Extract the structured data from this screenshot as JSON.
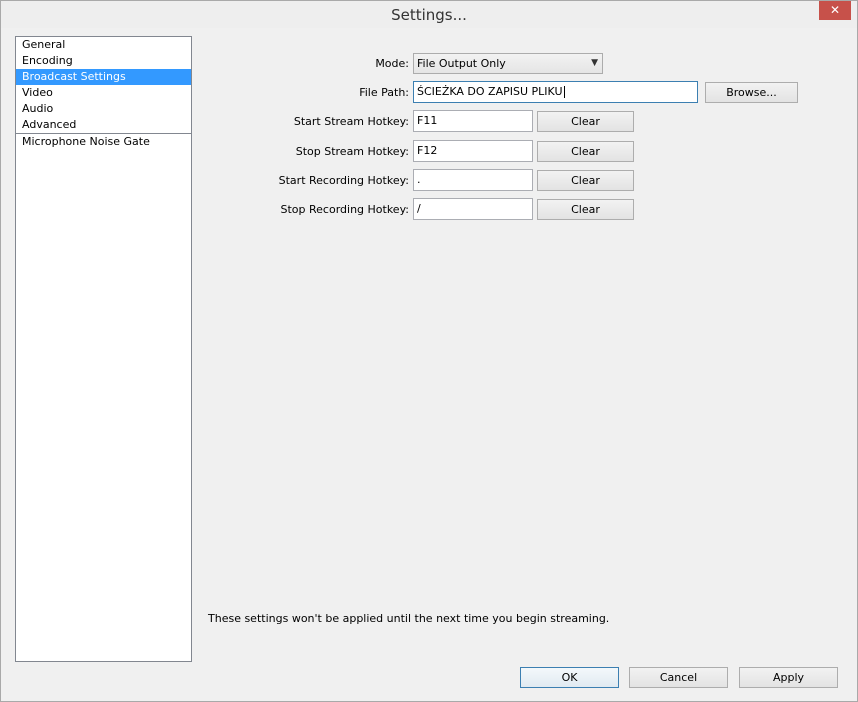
{
  "window": {
    "title": "Settings...",
    "close_glyph": "✕"
  },
  "sidebar": {
    "items": [
      {
        "label": "General"
      },
      {
        "label": "Encoding"
      },
      {
        "label": "Broadcast Settings",
        "selected": true
      },
      {
        "label": "Video"
      },
      {
        "label": "Audio"
      },
      {
        "label": "Advanced"
      },
      {
        "label": "Microphone Noise Gate"
      }
    ]
  },
  "form": {
    "mode": {
      "label": "Mode:",
      "value": "File Output Only"
    },
    "file_path": {
      "label": "File Path:",
      "value": "ŚCIEŻKA DO ZAPISU PLIKU",
      "browse_label": "Browse..."
    },
    "start_stream_hotkey": {
      "label": "Start Stream Hotkey:",
      "value": "F11",
      "clear_label": "Clear"
    },
    "stop_stream_hotkey": {
      "label": "Stop Stream Hotkey:",
      "value": "F12",
      "clear_label": "Clear"
    },
    "start_recording_hotkey": {
      "label": "Start Recording Hotkey:",
      "value": ".",
      "clear_label": "Clear"
    },
    "stop_recording_hotkey": {
      "label": "Stop Recording Hotkey:",
      "value": "/",
      "clear_label": "Clear"
    }
  },
  "note": "These settings won't be applied until the next time you begin streaming.",
  "footer": {
    "ok_label": "OK",
    "cancel_label": "Cancel",
    "apply_label": "Apply"
  },
  "colors": {
    "selection": "#3399ff",
    "close_button": "#c7514a",
    "focus_border": "#3c7fb1"
  }
}
